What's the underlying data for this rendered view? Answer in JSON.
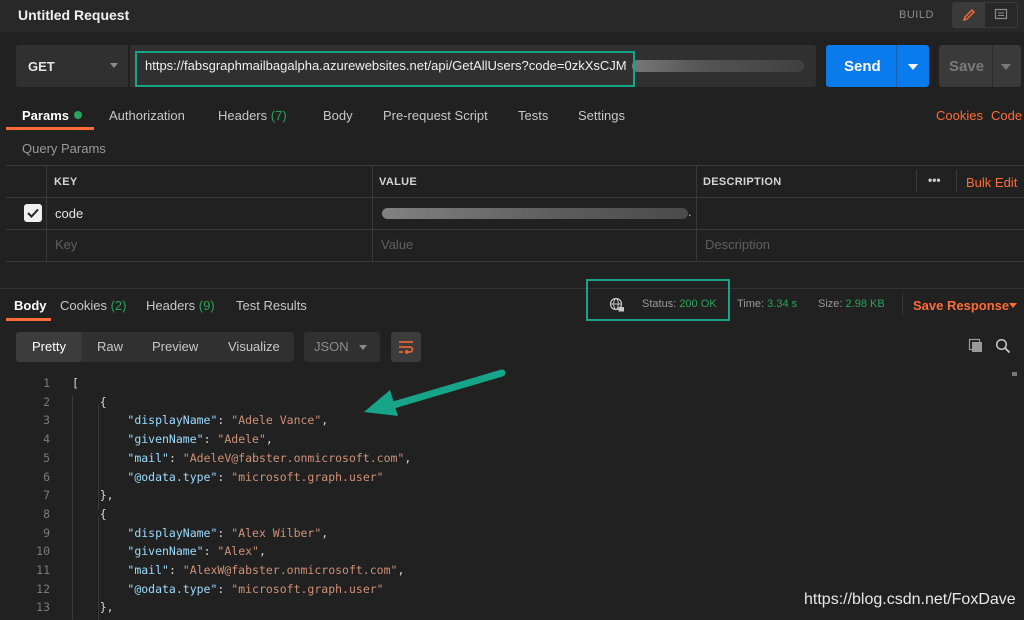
{
  "window": {
    "title": "Untitled Request",
    "build_label": "BUILD"
  },
  "request": {
    "method": "GET",
    "url": "https://fabsgraphmailbagalpha.azurewebsites.net/api/GetAllUsers?code=0zkXsCJM",
    "send_label": "Send",
    "save_label": "Save"
  },
  "request_tabs": [
    {
      "label": "Params",
      "count": ""
    },
    {
      "label": "Authorization",
      "count": ""
    },
    {
      "label": "Headers",
      "count": "(7)"
    },
    {
      "label": "Body",
      "count": ""
    },
    {
      "label": "Pre-request Script",
      "count": ""
    },
    {
      "label": "Tests",
      "count": ""
    },
    {
      "label": "Settings",
      "count": ""
    }
  ],
  "links": {
    "cookies": "Cookies",
    "code": "Code"
  },
  "query_params": {
    "section_title": "Query Params",
    "headers": {
      "key": "KEY",
      "value": "VALUE",
      "description": "DESCRIPTION"
    },
    "more": "•••",
    "bulk_edit": "Bulk Edit",
    "rows": [
      {
        "checked": true,
        "key": "code",
        "value": "",
        "value_suffix": "."
      }
    ],
    "placeholders": {
      "key": "Key",
      "value": "Value",
      "description": "Description"
    }
  },
  "response_tabs": [
    {
      "label": "Body",
      "count": ""
    },
    {
      "label": "Cookies",
      "count": "(2)"
    },
    {
      "label": "Headers",
      "count": "(9)"
    },
    {
      "label": "Test Results",
      "count": ""
    }
  ],
  "response_meta": {
    "status_label": "Status:",
    "status_value": "200 OK",
    "time_label": "Time:",
    "time_value": "3.34 s",
    "size_label": "Size:",
    "size_value": "2.98 KB",
    "save_response": "Save Response"
  },
  "view_modes": [
    "Pretty",
    "Raw",
    "Preview",
    "Visualize"
  ],
  "format": "JSON",
  "code_lines": [
    {
      "n": "1",
      "text": "["
    },
    {
      "n": "2",
      "text": "    {"
    },
    {
      "n": "3",
      "key": "\"displayName\"",
      "val": "\"Adele Vance\""
    },
    {
      "n": "4",
      "key": "\"givenName\"",
      "val": "\"Adele\""
    },
    {
      "n": "5",
      "key": "\"mail\"",
      "val": "\"AdeleV@fabster.onmicrosoft.com\""
    },
    {
      "n": "6",
      "key": "\"@odata.type\"",
      "val": "\"microsoft.graph.user\"",
      "last": true
    },
    {
      "n": "7",
      "text": "    },"
    },
    {
      "n": "8",
      "text": "    {"
    },
    {
      "n": "9",
      "key": "\"displayName\"",
      "val": "\"Alex Wilber\""
    },
    {
      "n": "10",
      "key": "\"givenName\"",
      "val": "\"Alex\""
    },
    {
      "n": "11",
      "key": "\"mail\"",
      "val": "\"AlexW@fabster.onmicrosoft.com\""
    },
    {
      "n": "12",
      "key": "\"@odata.type\"",
      "val": "\"microsoft.graph.user\"",
      "last": true
    },
    {
      "n": "13",
      "text": "    },"
    }
  ],
  "watermark": "https://blog.csdn.net/FoxDave",
  "colors": {
    "accent": "#ff6c37",
    "send": "#097bed",
    "highlight": "#17a589",
    "success": "#29a35a"
  },
  "icons": [
    "pencil-icon",
    "comment-icon",
    "globe-lock-icon",
    "copy-icon",
    "search-icon",
    "wrap-icon"
  ]
}
